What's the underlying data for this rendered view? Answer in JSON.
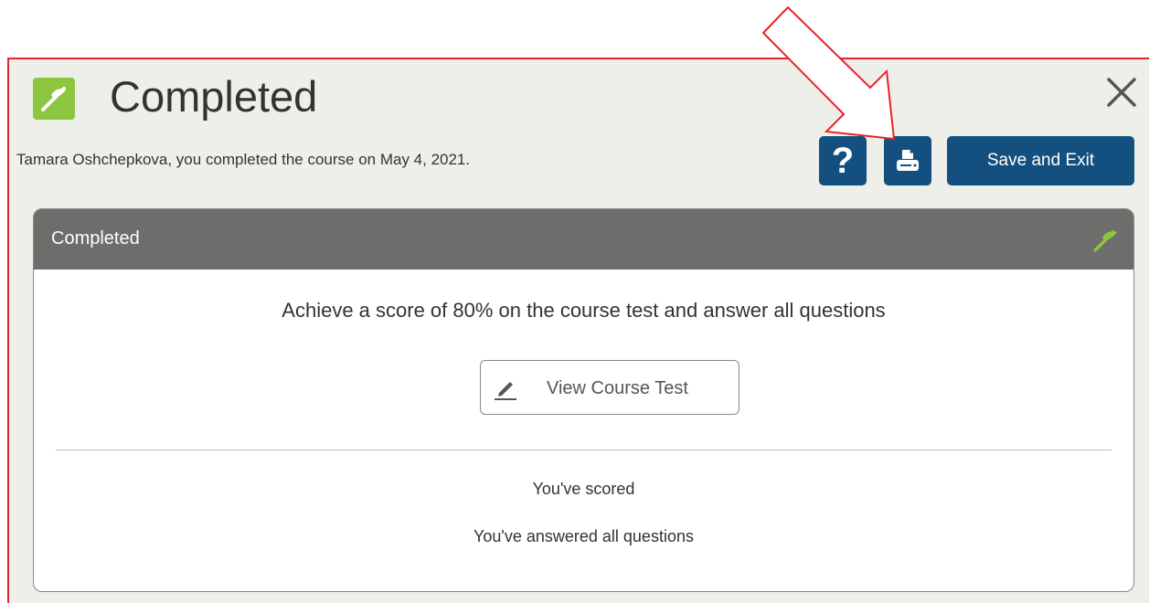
{
  "dialog": {
    "title": "Completed",
    "subtitle": "Tamara Oshchepkova, you completed the course on May 4, 2021.",
    "icons": {
      "header": "completed-flag-icon",
      "close": "close-icon",
      "help": "question-icon",
      "print": "printer-icon"
    },
    "help_label": "?",
    "save_label": "Save and Exit",
    "colors": {
      "primary_button": "#14507f",
      "completed_green": "#8cc63f",
      "panel_header": "#6d6d6b",
      "annotation_red": "#e8222a"
    }
  },
  "panel": {
    "header_title": "Completed",
    "requirement": "Achieve a score of 80% on the course test and answer all questions",
    "view_test_label": "View Course Test",
    "status": [
      "You've scored",
      "You've answered all questions"
    ]
  }
}
